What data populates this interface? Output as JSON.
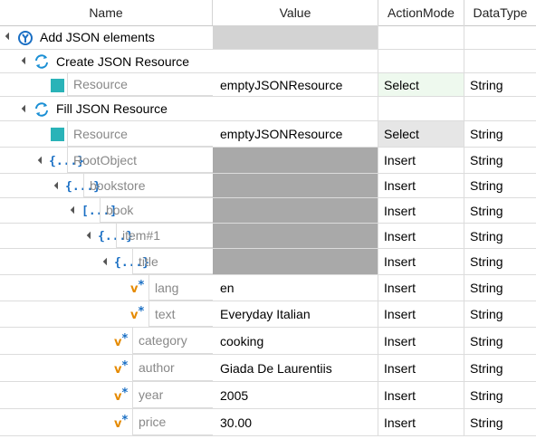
{
  "columns": {
    "name": "Name",
    "value": "Value",
    "action_mode": "ActionMode",
    "data_type": "DataType"
  },
  "rows": [
    {
      "name": "Add JSON elements",
      "value": "",
      "action_mode": "",
      "data_type": "",
      "icon": "module-icon"
    },
    {
      "name": "Create JSON Resource",
      "value": "",
      "action_mode": "",
      "data_type": "",
      "icon": "refresh-icon"
    },
    {
      "name": "Resource",
      "value": "emptyJSONResource",
      "action_mode": "Select",
      "data_type": "String",
      "icon": "teal-square-icon"
    },
    {
      "name": "Fill JSON Resource",
      "value": "",
      "action_mode": "",
      "data_type": "",
      "icon": "refresh-icon"
    },
    {
      "name": "Resource",
      "value": "emptyJSONResource",
      "action_mode": "Select",
      "data_type": "String",
      "icon": "teal-square-icon"
    },
    {
      "name": "RootObject",
      "value": "",
      "action_mode": "Insert",
      "data_type": "String",
      "icon": "object-braces-icon"
    },
    {
      "name": "bookstore",
      "value": "",
      "action_mode": "Insert",
      "data_type": "String",
      "icon": "object-braces-icon"
    },
    {
      "name": "book",
      "value": "",
      "action_mode": "Insert",
      "data_type": "String",
      "icon": "array-brackets-icon"
    },
    {
      "name": "item#1",
      "value": "",
      "action_mode": "Insert",
      "data_type": "String",
      "icon": "object-braces-icon"
    },
    {
      "name": "title",
      "value": "",
      "action_mode": "Insert",
      "data_type": "String",
      "icon": "object-braces-icon"
    },
    {
      "name": "lang",
      "value": "en",
      "action_mode": "Insert",
      "data_type": "String",
      "icon": "value-star-icon"
    },
    {
      "name": "text",
      "value": "Everyday Italian",
      "action_mode": "Insert",
      "data_type": "String",
      "icon": "value-star-icon"
    },
    {
      "name": "category",
      "value": "cooking",
      "action_mode": "Insert",
      "data_type": "String",
      "icon": "value-star-icon"
    },
    {
      "name": "author",
      "value": "Giada De Laurentiis",
      "action_mode": "Insert",
      "data_type": "String",
      "icon": "value-star-icon"
    },
    {
      "name": "year",
      "value": "2005",
      "action_mode": "Insert",
      "data_type": "String",
      "icon": "value-star-icon"
    },
    {
      "name": "price",
      "value": "30.00",
      "action_mode": "Insert",
      "data_type": "String",
      "icon": "value-star-icon"
    }
  ],
  "icon_glyphs": {
    "object_braces": "{...}",
    "array_brackets": "[...]",
    "value_v": "v",
    "value_star": "*"
  },
  "colors": {
    "teal": "#2ab3b8",
    "blue": "#1a6fc4",
    "orange": "#e58a00",
    "gray_fill": "#a9a9a9",
    "light_gray_fill": "#d3d3d3",
    "select_green": "#eef9ee"
  }
}
